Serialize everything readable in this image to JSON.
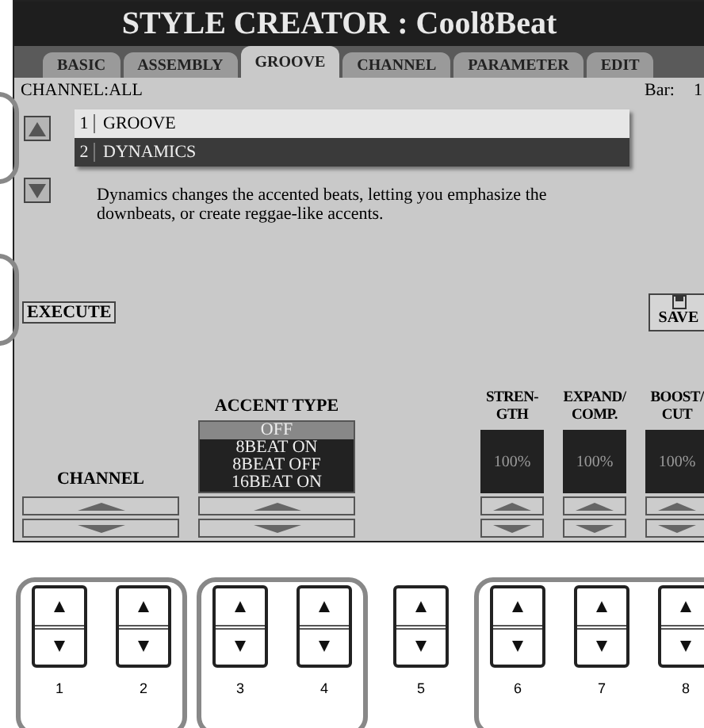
{
  "title": "STYLE CREATOR : Cool8Beat",
  "tabs": [
    {
      "label": "BASIC",
      "selected": false
    },
    {
      "label": "ASSEMBLY",
      "selected": false
    },
    {
      "label": "GROOVE",
      "selected": true
    },
    {
      "label": "CHANNEL",
      "selected": false
    },
    {
      "label": "PARAMETER",
      "selected": false
    },
    {
      "label": "EDIT",
      "selected": false
    }
  ],
  "channel_label": "CHANNEL:ALL",
  "bar_label": "Bar:",
  "bar_value": "1",
  "list": [
    {
      "number": "1",
      "label": "GROOVE",
      "selected": false
    },
    {
      "number": "2",
      "label": "DYNAMICS",
      "selected": true
    }
  ],
  "description": "Dynamics changes the accented beats, letting you emphasize the downbeats, or create reggae-like accents.",
  "execute_button": "EXECUTE",
  "save_button": "SAVE",
  "channel_control": {
    "label": "CHANNEL"
  },
  "accent_type": {
    "label": "ACCENT TYPE",
    "options": [
      {
        "label": "OFF",
        "selected": true
      },
      {
        "label": "8BEAT ON",
        "selected": false
      },
      {
        "label": "8BEAT OFF",
        "selected": false
      },
      {
        "label": "16BEAT ON",
        "selected": false
      }
    ]
  },
  "value_controls": [
    {
      "label": "STREN-\nGTH",
      "value": "100%"
    },
    {
      "label": "EXPAND/\nCOMP.",
      "value": "100%"
    },
    {
      "label": "BOOST/\nCUT",
      "value": "100%"
    }
  ],
  "hardware_groups": [
    {
      "framed": true,
      "buttons": [
        "1",
        "2"
      ]
    },
    {
      "framed": true,
      "buttons": [
        "3",
        "4"
      ]
    },
    {
      "framed": false,
      "buttons": [
        "5"
      ]
    },
    {
      "framed": true,
      "buttons": [
        "6",
        "7",
        "8"
      ]
    }
  ]
}
